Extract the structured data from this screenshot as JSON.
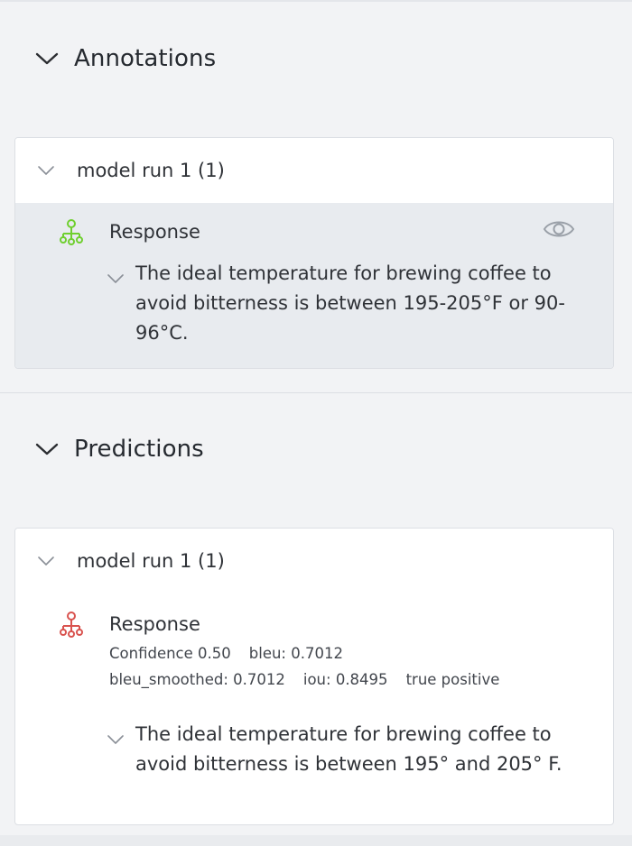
{
  "annotations": {
    "title": "Annotations",
    "card": {
      "title": "model run 1 (1)",
      "item": {
        "label": "Response",
        "text": "The ideal temperature for brewing coffee to avoid bitterness is between 195-205°F or 90-96°C.",
        "icon": "response-tree-icon",
        "icon_color": "#6fcf2f"
      }
    }
  },
  "predictions": {
    "title": "Predictions",
    "card": {
      "title": "model run 1 (1)",
      "item": {
        "label": "Response",
        "metrics": {
          "confidence": "Confidence 0.50",
          "bleu": "bleu: 0.7012",
          "bleu_smoothed": "bleu_smoothed: 0.7012",
          "iou": "iou: 0.8495",
          "result": "true positive"
        },
        "text": "The ideal temperature for brewing coffee to avoid bitterness is between 195° and 205° F.",
        "icon": "response-tree-icon",
        "icon_color": "#d9534f"
      }
    }
  },
  "colors": {
    "background": "#f2f3f5",
    "card": "#ffffff",
    "highlight": "#e8ebef"
  }
}
